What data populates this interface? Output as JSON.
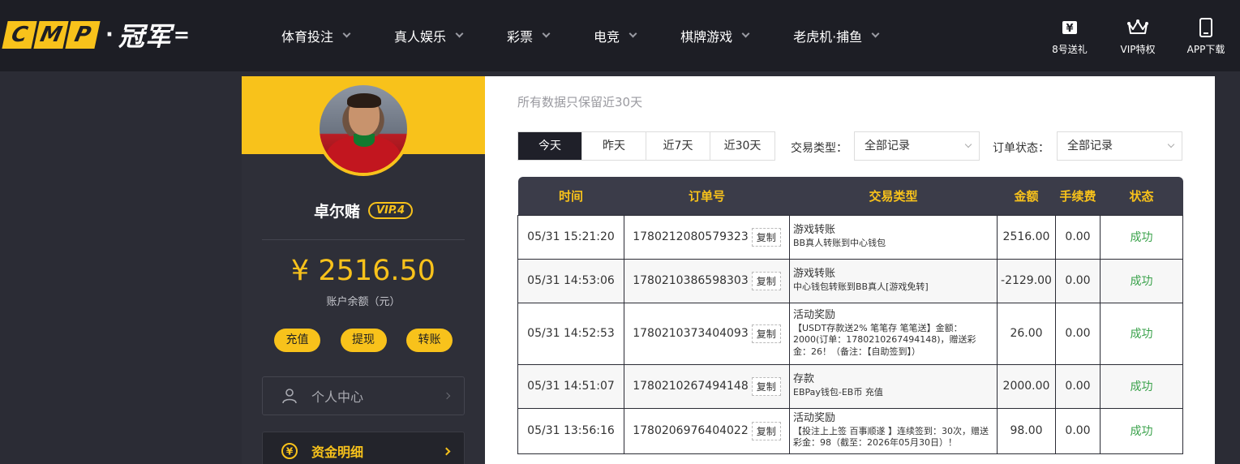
{
  "brand": {
    "cmp_letters": [
      "C",
      "M",
      "P"
    ],
    "separator": "·",
    "cn_name": "冠军"
  },
  "nav": [
    {
      "label": "体育投注"
    },
    {
      "label": "真人娱乐"
    },
    {
      "label": "彩票"
    },
    {
      "label": "电竞"
    },
    {
      "label": "棋牌游戏"
    },
    {
      "label": "老虎机·捕鱼"
    }
  ],
  "header_icons": [
    {
      "label": "8号送礼",
      "icon": "yen-gift-icon"
    },
    {
      "label": "VIP特权",
      "icon": "crown-icon"
    },
    {
      "label": "APP下载",
      "icon": "phone-icon"
    }
  ],
  "user": {
    "name": "卓尔赌",
    "vip": "VIP.4",
    "balance": "¥ 2516.50",
    "balance_label": "账户余额（元）",
    "actions": [
      "充值",
      "提现",
      "转账"
    ]
  },
  "sidebar_menu": [
    {
      "label": "个人中心",
      "icon": "user-icon"
    },
    {
      "label": "资金明细",
      "icon": "yen-coin-icon"
    }
  ],
  "main": {
    "subtitle": "所有数据只保留近30天",
    "range_tabs": [
      "今天",
      "昨天",
      "近7天",
      "近30天"
    ],
    "active_tab": 0,
    "filter_type_label": "交易类型：",
    "filter_type_value": "全部记录",
    "filter_status_label": "订单状态：",
    "filter_status_value": "全部记录"
  },
  "table": {
    "headers": [
      "时间",
      "订单号",
      "交易类型",
      "金额",
      "手续费",
      "状态"
    ],
    "copy_label": "复制",
    "rows": [
      {
        "time": "05/31 15:21:20",
        "order": "1780212080579323",
        "type": "游戏转账",
        "desc": "BB真人转账到中心钱包",
        "amount": "2516.00",
        "fee": "0.00",
        "status": "成功"
      },
      {
        "time": "05/31 14:53:06",
        "order": "1780210386598303",
        "type": "游戏转账",
        "desc": "中心钱包转账到BB真人[游戏免转]",
        "amount": "-2129.00",
        "fee": "0.00",
        "status": "成功"
      },
      {
        "time": "05/31 14:52:53",
        "order": "1780210373404093",
        "type": "活动奖励",
        "desc": "【USDT存款送2% 笔笔存 笔笔送】金额：2000(订单：1780210267494148)，赠送彩金：26！（备注：【自助签到】）",
        "amount": "26.00",
        "fee": "0.00",
        "status": "成功"
      },
      {
        "time": "05/31 14:51:07",
        "order": "1780210267494148",
        "type": "存款",
        "desc": "EBPay钱包-EB币 充值",
        "amount": "2000.00",
        "fee": "0.00",
        "status": "成功"
      },
      {
        "time": "05/31 13:56:16",
        "order": "1780206976404022",
        "type": "活动奖励",
        "desc": "【投注上上签 百事顺遂 】连续签到：30次，赠送彩金：98（截至：2026年05月30日）！",
        "amount": "98.00",
        "fee": "0.00",
        "status": "成功"
      }
    ]
  },
  "colors": {
    "accent": "#f8c21b",
    "header_bg": "#1d1e25",
    "page_bg": "#2b2c35",
    "success": "#3aa24b"
  }
}
